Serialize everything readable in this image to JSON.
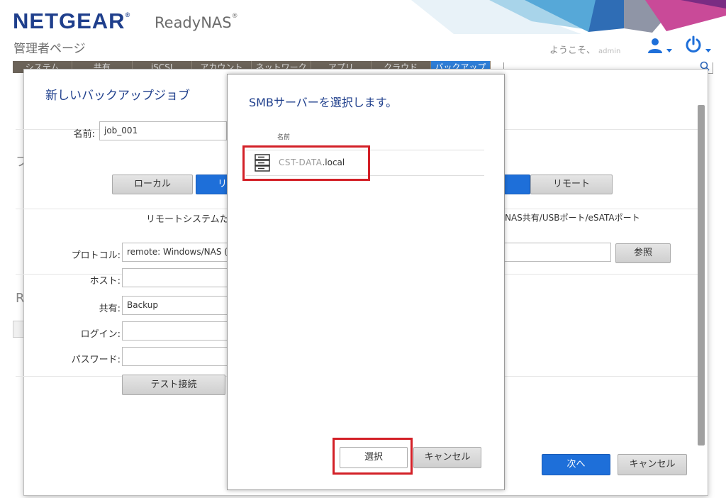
{
  "header": {
    "logo": "NETGEAR",
    "logo_mark": "®",
    "product": "ReadyNAS",
    "product_mark": "®",
    "admin_page": "管理者ページ",
    "welcome": "ようこそ、",
    "username": "admin"
  },
  "nav": {
    "tabs": [
      "システム",
      "共有",
      "iSCSI",
      "アカウント",
      "ネットワーク",
      "アプリ",
      "クラウド",
      "バックアップ"
    ],
    "active_index": 7
  },
  "backup_dialog": {
    "title": "新しいバックアップジョブ",
    "name_label": "名前:",
    "name_value": "job_001",
    "seg_local": "ローカル",
    "seg_remote_partial": "リ",
    "seg_remote": "リモート",
    "info_left": "リモートシステムた",
    "info_right": "NAS共有/USBポート/eSATAポート",
    "protocol_label": "プロトコル:",
    "protocol_value": "remote: Windows/NAS (",
    "browse_button": "参照",
    "host_label": "ホスト:",
    "share_label": "共有:",
    "share_value": "Backup",
    "login_label": "ログイン:",
    "password_label": "パスワード:",
    "test_button": "テスト接続",
    "next_button": "次へ",
    "cancel_button": "キャンセル"
  },
  "background": {
    "left_fragment_1": "フ",
    "left_fragment_2": "R"
  },
  "smb_dialog": {
    "title": "SMBサーバーを選択します。",
    "column_header": "名前",
    "server_blurred": "CST-DATA",
    "server_suffix": ".local",
    "select_button": "選択",
    "cancel_button": "キャンセル"
  },
  "colors": {
    "brand": "#1f3f8c",
    "accent": "#1e6fd9",
    "highlight": "#d32027",
    "nav_bg": "#6b6359"
  },
  "icons": {
    "user": "user-icon",
    "power": "power-icon",
    "search": "search-icon",
    "server": "server-icon"
  }
}
